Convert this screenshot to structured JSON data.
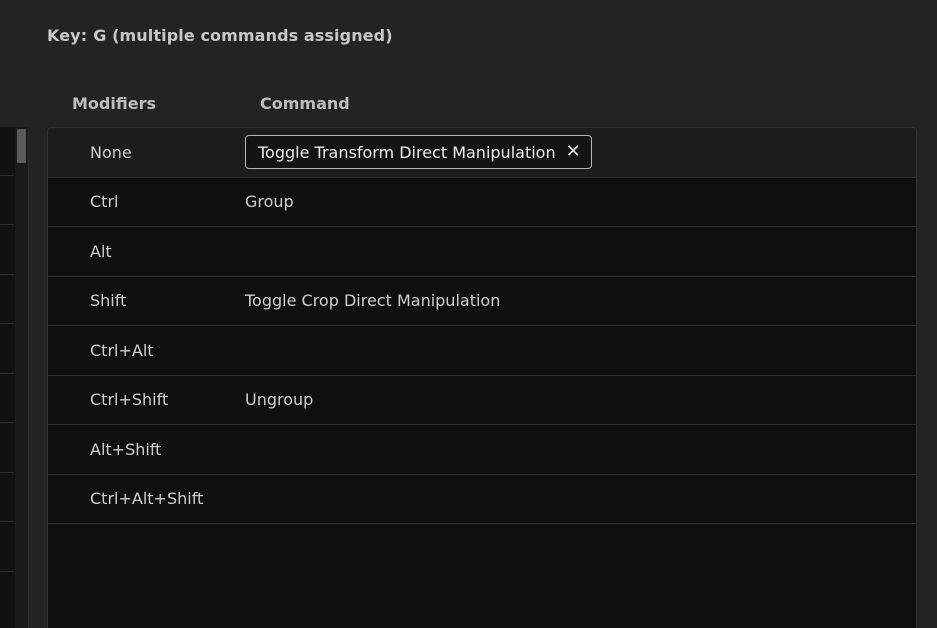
{
  "header": {
    "key_prefix": "Key:",
    "key_value": "G (multiple commands assigned)"
  },
  "columns": {
    "modifiers": "Modifiers",
    "command": "Command"
  },
  "rows": [
    {
      "modifier": "None",
      "command": "Toggle Transform Direct Manipulation",
      "editing": true
    },
    {
      "modifier": "Ctrl",
      "command": "Group"
    },
    {
      "modifier": "Alt",
      "command": ""
    },
    {
      "modifier": "Shift",
      "command": "Toggle Crop Direct Manipulation"
    },
    {
      "modifier": "Ctrl+Alt",
      "command": ""
    },
    {
      "modifier": "Ctrl+Shift",
      "command": "Ungroup"
    },
    {
      "modifier": "Alt+Shift",
      "command": ""
    },
    {
      "modifier": "Ctrl+Alt+Shift",
      "command": ""
    }
  ],
  "icons": {
    "clear": "close-icon"
  }
}
